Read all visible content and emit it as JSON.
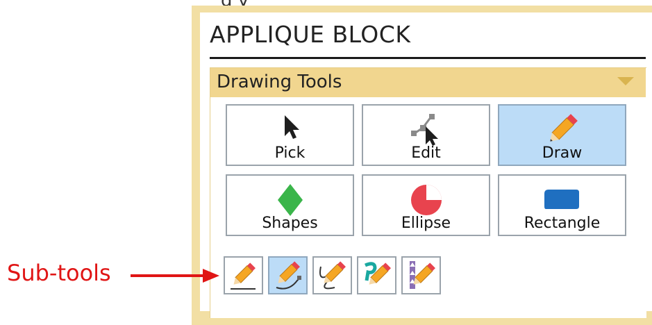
{
  "caption_fragment": "g                        y",
  "panel": {
    "title": "APPLIQUE BLOCK",
    "section": {
      "label": "Drawing Tools",
      "collapse_icon": "chevron-down-icon"
    }
  },
  "tools": [
    {
      "label": "Pick",
      "icon": "arrow-cursor-icon",
      "active": false
    },
    {
      "label": "Edit",
      "icon": "node-edit-icon",
      "active": false
    },
    {
      "label": "Draw",
      "icon": "pencil-icon",
      "active": true
    },
    {
      "label": "Shapes",
      "icon": "diamond-icon",
      "active": false
    },
    {
      "label": "Ellipse",
      "icon": "pie-ellipse-icon",
      "active": false
    },
    {
      "label": "Rectangle",
      "icon": "rounded-rectangle-icon",
      "active": false
    }
  ],
  "sub_tools": [
    {
      "icon": "pencil-line-icon",
      "active": false
    },
    {
      "icon": "pencil-curve-icon",
      "active": true
    },
    {
      "icon": "pencil-freehand-icon",
      "active": false
    },
    {
      "icon": "pencil-hook-icon",
      "active": false
    },
    {
      "icon": "pencil-steps-icon",
      "active": false
    }
  ],
  "callout": {
    "label": "Sub-tools",
    "color": "#e01515"
  },
  "colors": {
    "panel_border": "#f2dfa4",
    "section_header": "#f1d68f",
    "active_button": "#bcdcf7",
    "pencil_body": "#f5a623",
    "pencil_tip": "#e8434e",
    "diamond": "#3ab54a",
    "ellipse": "#e8434e",
    "rectangle": "#1f6fc0"
  }
}
